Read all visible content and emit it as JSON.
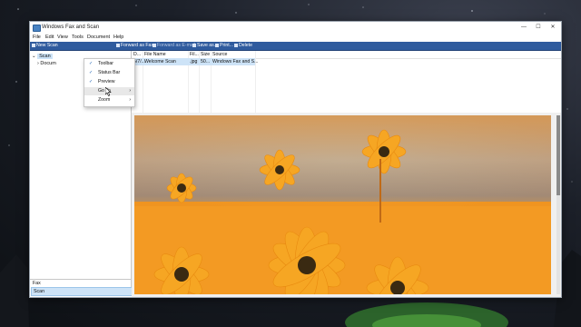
{
  "window": {
    "title": "Windows Fax and Scan",
    "controls": {
      "minimize": "—",
      "maximize": "☐",
      "close": "✕"
    }
  },
  "menubar": {
    "items": [
      "File",
      "Edit",
      "View",
      "Tools",
      "Document",
      "Help"
    ]
  },
  "toolbar": {
    "new_scan": "New Scan",
    "forward_fax": "Forward as Fax",
    "forward_email": "Forward as E-mail",
    "save_as": "Save as...",
    "print": "Print...",
    "delete": "Delete"
  },
  "tree": {
    "scan": "Scan",
    "documents": "Docum"
  },
  "left_bottom": {
    "fax": "Fax",
    "scan": "Scan"
  },
  "view_menu": {
    "items": [
      {
        "label": "Toolbar",
        "checked": "✓",
        "arrow": ""
      },
      {
        "label": "Status Bar",
        "checked": "✓",
        "arrow": ""
      },
      {
        "label": "Preview",
        "checked": "✓",
        "arrow": ""
      },
      {
        "label": "Go To",
        "checked": "",
        "arrow": "›"
      },
      {
        "label": "Zoom",
        "checked": "",
        "arrow": "›"
      }
    ]
  },
  "list": {
    "headers": [
      "D...",
      "File Name",
      "Fil...",
      "Size",
      "Source"
    ],
    "rows": [
      {
        "date": "5/7/...",
        "name": "Welcome Scan",
        "type": ".jpg",
        "size": "50...",
        "source": "Windows Fax and S..."
      }
    ]
  },
  "colors": {
    "toolbar": "#2f5b9e",
    "selection": "#cde3f7",
    "petal": "#f7a21c",
    "flower_center": "#3a2a12"
  }
}
